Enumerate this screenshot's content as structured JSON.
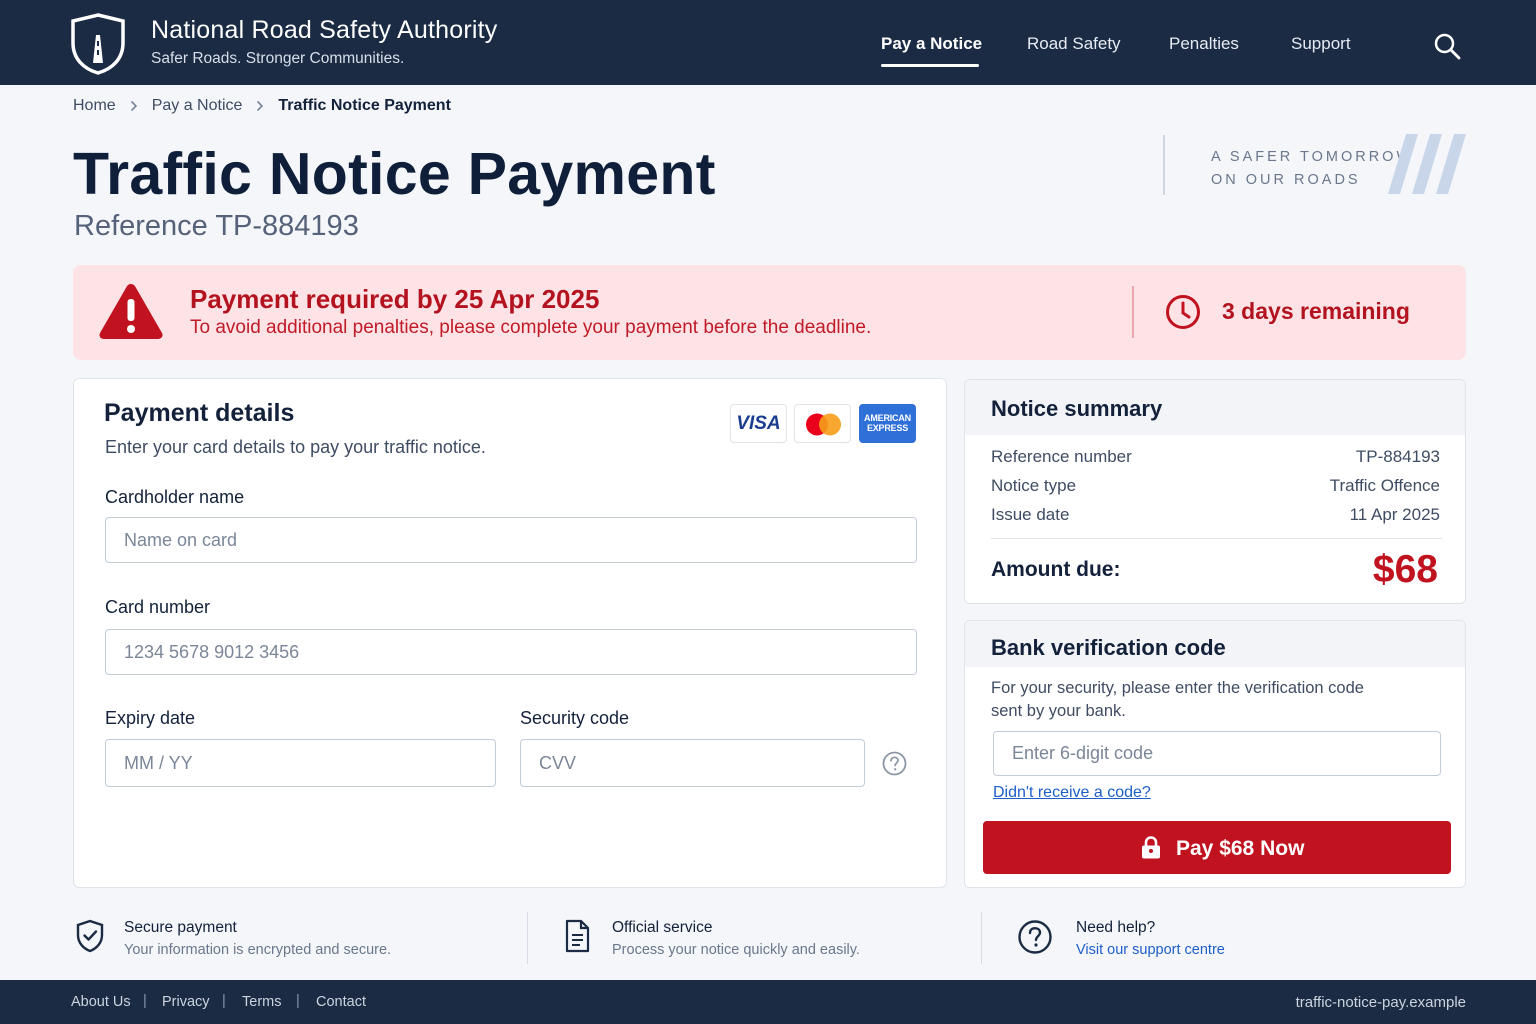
{
  "header": {
    "title": "National Road Safety Authority",
    "subtitle": "Safer Roads. Stronger Communities.",
    "logo_icon": "shield-road-icon",
    "nav": [
      "Pay a Notice",
      "Road Safety",
      "Penalties",
      "Support"
    ],
    "active_nav": "Pay a Notice",
    "search_icon": "search-icon"
  },
  "breadcrumb": {
    "items": [
      "Home",
      "Pay a Notice",
      "Traffic Notice Payment"
    ]
  },
  "page": {
    "title": "Traffic Notice Payment",
    "reference": "Reference TP-884193",
    "tagline_line1": "A SAFER TOMORROW",
    "tagline_line2": "ON OUR ROADS"
  },
  "alert": {
    "title": "Payment required by 25 Apr 2025",
    "text": "To avoid additional penalties, please complete your payment before the deadline.",
    "remaining": "3 days remaining",
    "color": "#b3121f"
  },
  "payment": {
    "title": "Payment details",
    "subtitle": "Enter your card details to pay your traffic notice.",
    "card_brands": {
      "visa": "VISA",
      "mastercard_icon": "mastercard-icon",
      "amex_line1": "AMERICAN",
      "amex_line2": "EXPRESS"
    },
    "cardholder_label": "Cardholder name",
    "cardholder_placeholder": "Name on card",
    "cardholder_value": "",
    "card_number_label": "Card number",
    "card_number_placeholder": "1234 5678 9012 3456",
    "card_number_value": "",
    "expiry_label": "Expiry date",
    "expiry_placeholder": "MM / YY",
    "expiry_value": "",
    "security_label": "Security code",
    "security_placeholder": "CVV",
    "security_value": ""
  },
  "summary": {
    "title": "Notice summary",
    "rows": [
      {
        "label": "Reference number",
        "value": "TP-884193"
      },
      {
        "label": "Notice type",
        "value": "Traffic Offence"
      },
      {
        "label": "Issue date",
        "value": "11 Apr 2025"
      }
    ],
    "amount_label": "Amount due:",
    "amount_value": "$68"
  },
  "verification": {
    "title": "Bank verification code",
    "text": "For your security, please enter the verification code sent by your bank.",
    "code_placeholder": "Enter 6-digit code",
    "code_value": "",
    "resend_link": "Didn't receive a code?",
    "pay_button": "Pay $68 Now"
  },
  "features": [
    {
      "title": "Secure payment",
      "text": "Your information is encrypted and secure.",
      "icon": "shield-check-icon"
    },
    {
      "title": "Official service",
      "text": "Process your notice quickly and easily.",
      "icon": "document-icon"
    },
    {
      "title": "Need help?",
      "link": "Visit our support centre",
      "icon": "question-circle-icon"
    }
  ],
  "footer": {
    "links": [
      "About Us",
      "Privacy",
      "Terms",
      "Contact"
    ],
    "domain": "traffic-notice-pay.example"
  },
  "colors": {
    "navy": "#1b2b44",
    "danger": "#c0121f",
    "alert_bg": "#fde3e6",
    "link": "#1d5fc9"
  }
}
